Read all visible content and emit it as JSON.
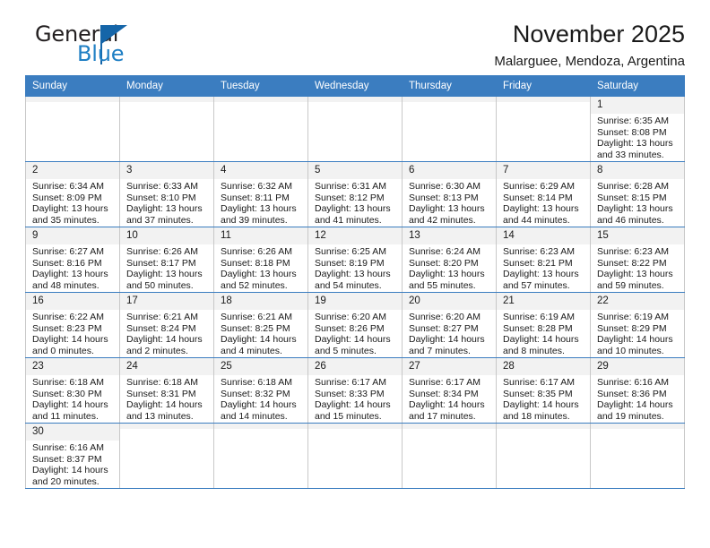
{
  "brand": {
    "name_top": "General",
    "name_bottom": "Blue",
    "accent_color": "#1565a8",
    "blue_text_color": "#1f7fc4"
  },
  "header": {
    "title": "November 2025",
    "subtitle": "Malarguee, Mendoza, Argentina"
  },
  "calendar": {
    "header_bg": "#3b7dc0",
    "daynum_bg": "#f2f2f2",
    "weekday_headers": [
      "Sunday",
      "Monday",
      "Tuesday",
      "Wednesday",
      "Thursday",
      "Friday",
      "Saturday"
    ],
    "labels": {
      "sunrise": "Sunrise:",
      "sunset": "Sunset:",
      "daylight": "Daylight:"
    },
    "weeks": [
      [
        {
          "day": ""
        },
        {
          "day": ""
        },
        {
          "day": ""
        },
        {
          "day": ""
        },
        {
          "day": ""
        },
        {
          "day": ""
        },
        {
          "day": "1",
          "sunrise": "Sunrise: 6:35 AM",
          "sunset": "Sunset: 8:08 PM",
          "daylight_line1": "Daylight: 13 hours",
          "daylight_line2": "and 33 minutes."
        }
      ],
      [
        {
          "day": "2",
          "sunrise": "Sunrise: 6:34 AM",
          "sunset": "Sunset: 8:09 PM",
          "daylight_line1": "Daylight: 13 hours",
          "daylight_line2": "and 35 minutes."
        },
        {
          "day": "3",
          "sunrise": "Sunrise: 6:33 AM",
          "sunset": "Sunset: 8:10 PM",
          "daylight_line1": "Daylight: 13 hours",
          "daylight_line2": "and 37 minutes."
        },
        {
          "day": "4",
          "sunrise": "Sunrise: 6:32 AM",
          "sunset": "Sunset: 8:11 PM",
          "daylight_line1": "Daylight: 13 hours",
          "daylight_line2": "and 39 minutes."
        },
        {
          "day": "5",
          "sunrise": "Sunrise: 6:31 AM",
          "sunset": "Sunset: 8:12 PM",
          "daylight_line1": "Daylight: 13 hours",
          "daylight_line2": "and 41 minutes."
        },
        {
          "day": "6",
          "sunrise": "Sunrise: 6:30 AM",
          "sunset": "Sunset: 8:13 PM",
          "daylight_line1": "Daylight: 13 hours",
          "daylight_line2": "and 42 minutes."
        },
        {
          "day": "7",
          "sunrise": "Sunrise: 6:29 AM",
          "sunset": "Sunset: 8:14 PM",
          "daylight_line1": "Daylight: 13 hours",
          "daylight_line2": "and 44 minutes."
        },
        {
          "day": "8",
          "sunrise": "Sunrise: 6:28 AM",
          "sunset": "Sunset: 8:15 PM",
          "daylight_line1": "Daylight: 13 hours",
          "daylight_line2": "and 46 minutes."
        }
      ],
      [
        {
          "day": "9",
          "sunrise": "Sunrise: 6:27 AM",
          "sunset": "Sunset: 8:16 PM",
          "daylight_line1": "Daylight: 13 hours",
          "daylight_line2": "and 48 minutes."
        },
        {
          "day": "10",
          "sunrise": "Sunrise: 6:26 AM",
          "sunset": "Sunset: 8:17 PM",
          "daylight_line1": "Daylight: 13 hours",
          "daylight_line2": "and 50 minutes."
        },
        {
          "day": "11",
          "sunrise": "Sunrise: 6:26 AM",
          "sunset": "Sunset: 8:18 PM",
          "daylight_line1": "Daylight: 13 hours",
          "daylight_line2": "and 52 minutes."
        },
        {
          "day": "12",
          "sunrise": "Sunrise: 6:25 AM",
          "sunset": "Sunset: 8:19 PM",
          "daylight_line1": "Daylight: 13 hours",
          "daylight_line2": "and 54 minutes."
        },
        {
          "day": "13",
          "sunrise": "Sunrise: 6:24 AM",
          "sunset": "Sunset: 8:20 PM",
          "daylight_line1": "Daylight: 13 hours",
          "daylight_line2": "and 55 minutes."
        },
        {
          "day": "14",
          "sunrise": "Sunrise: 6:23 AM",
          "sunset": "Sunset: 8:21 PM",
          "daylight_line1": "Daylight: 13 hours",
          "daylight_line2": "and 57 minutes."
        },
        {
          "day": "15",
          "sunrise": "Sunrise: 6:23 AM",
          "sunset": "Sunset: 8:22 PM",
          "daylight_line1": "Daylight: 13 hours",
          "daylight_line2": "and 59 minutes."
        }
      ],
      [
        {
          "day": "16",
          "sunrise": "Sunrise: 6:22 AM",
          "sunset": "Sunset: 8:23 PM",
          "daylight_line1": "Daylight: 14 hours",
          "daylight_line2": "and 0 minutes."
        },
        {
          "day": "17",
          "sunrise": "Sunrise: 6:21 AM",
          "sunset": "Sunset: 8:24 PM",
          "daylight_line1": "Daylight: 14 hours",
          "daylight_line2": "and 2 minutes."
        },
        {
          "day": "18",
          "sunrise": "Sunrise: 6:21 AM",
          "sunset": "Sunset: 8:25 PM",
          "daylight_line1": "Daylight: 14 hours",
          "daylight_line2": "and 4 minutes."
        },
        {
          "day": "19",
          "sunrise": "Sunrise: 6:20 AM",
          "sunset": "Sunset: 8:26 PM",
          "daylight_line1": "Daylight: 14 hours",
          "daylight_line2": "and 5 minutes."
        },
        {
          "day": "20",
          "sunrise": "Sunrise: 6:20 AM",
          "sunset": "Sunset: 8:27 PM",
          "daylight_line1": "Daylight: 14 hours",
          "daylight_line2": "and 7 minutes."
        },
        {
          "day": "21",
          "sunrise": "Sunrise: 6:19 AM",
          "sunset": "Sunset: 8:28 PM",
          "daylight_line1": "Daylight: 14 hours",
          "daylight_line2": "and 8 minutes."
        },
        {
          "day": "22",
          "sunrise": "Sunrise: 6:19 AM",
          "sunset": "Sunset: 8:29 PM",
          "daylight_line1": "Daylight: 14 hours",
          "daylight_line2": "and 10 minutes."
        }
      ],
      [
        {
          "day": "23",
          "sunrise": "Sunrise: 6:18 AM",
          "sunset": "Sunset: 8:30 PM",
          "daylight_line1": "Daylight: 14 hours",
          "daylight_line2": "and 11 minutes."
        },
        {
          "day": "24",
          "sunrise": "Sunrise: 6:18 AM",
          "sunset": "Sunset: 8:31 PM",
          "daylight_line1": "Daylight: 14 hours",
          "daylight_line2": "and 13 minutes."
        },
        {
          "day": "25",
          "sunrise": "Sunrise: 6:18 AM",
          "sunset": "Sunset: 8:32 PM",
          "daylight_line1": "Daylight: 14 hours",
          "daylight_line2": "and 14 minutes."
        },
        {
          "day": "26",
          "sunrise": "Sunrise: 6:17 AM",
          "sunset": "Sunset: 8:33 PM",
          "daylight_line1": "Daylight: 14 hours",
          "daylight_line2": "and 15 minutes."
        },
        {
          "day": "27",
          "sunrise": "Sunrise: 6:17 AM",
          "sunset": "Sunset: 8:34 PM",
          "daylight_line1": "Daylight: 14 hours",
          "daylight_line2": "and 17 minutes."
        },
        {
          "day": "28",
          "sunrise": "Sunrise: 6:17 AM",
          "sunset": "Sunset: 8:35 PM",
          "daylight_line1": "Daylight: 14 hours",
          "daylight_line2": "and 18 minutes."
        },
        {
          "day": "29",
          "sunrise": "Sunrise: 6:16 AM",
          "sunset": "Sunset: 8:36 PM",
          "daylight_line1": "Daylight: 14 hours",
          "daylight_line2": "and 19 minutes."
        }
      ],
      [
        {
          "day": "30",
          "sunrise": "Sunrise: 6:16 AM",
          "sunset": "Sunset: 8:37 PM",
          "daylight_line1": "Daylight: 14 hours",
          "daylight_line2": "and 20 minutes."
        },
        {
          "day": ""
        },
        {
          "day": ""
        },
        {
          "day": ""
        },
        {
          "day": ""
        },
        {
          "day": ""
        },
        {
          "day": ""
        }
      ]
    ]
  }
}
